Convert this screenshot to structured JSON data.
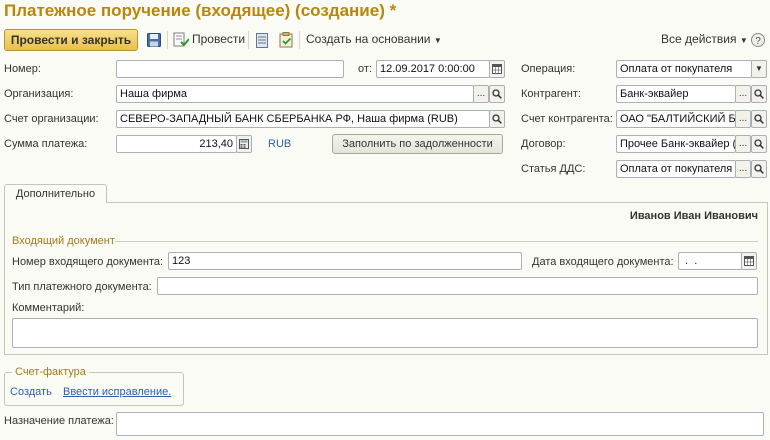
{
  "window": {
    "title": "Платежное поручение (входящее) (создание) *"
  },
  "toolbar": {
    "post_close": "Провести и закрыть",
    "save_icon": "save-icon",
    "post": "Провести",
    "create_based_on": "Создать на основании",
    "all_actions": "Все действия"
  },
  "form": {
    "number": {
      "label": "Номер:",
      "value": ""
    },
    "date": {
      "label": "от:",
      "value": "12.09.2017  0:00:00"
    },
    "operation": {
      "label": "Операция:",
      "value": "Оплата от покупателя"
    },
    "organization": {
      "label": "Организация:",
      "value": "Наша фирма"
    },
    "counterparty": {
      "label": "Контрагент:",
      "value": "Банк-эквайер"
    },
    "org_account": {
      "label": "Счет организации:",
      "value": "СЕВЕРО-ЗАПАДНЫЙ БАНК СБЕРБАНКА РФ, Наша фирма (RUB)"
    },
    "counterparty_account": {
      "label": "Счет контрагента:",
      "value": "ОАО \"БАЛТИЙСКИЙ Б"
    },
    "amount": {
      "label": "Сумма платежа:",
      "value": "213,40",
      "currency": "RUB"
    },
    "fill_debt": "Заполнить по задолженности",
    "contract": {
      "label": "Договор:",
      "value": "Прочее Банк-эквайер ("
    },
    "dds_item": {
      "label": "Статья ДДС:",
      "value": "Оплата от покупателя"
    }
  },
  "tabs": {
    "additional": "Дополнительно"
  },
  "additional": {
    "responsible": "Иванов Иван Иванович",
    "incoming_doc": {
      "section": "Входящий документ",
      "number_label": "Номер входящего документа:",
      "number_value": "123",
      "date_label": "Дата входящего документа:",
      "date_value": " .  .",
      "type_label": "Тип платежного документа:",
      "type_value": "",
      "comment_label": "Комментарий:",
      "comment_value": ""
    }
  },
  "invoice": {
    "section": "Счет-фактура",
    "create": "Создать",
    "enter_correction": "Ввести исправление."
  },
  "purpose": {
    "label": "Назначение платежа:",
    "value": ""
  }
}
